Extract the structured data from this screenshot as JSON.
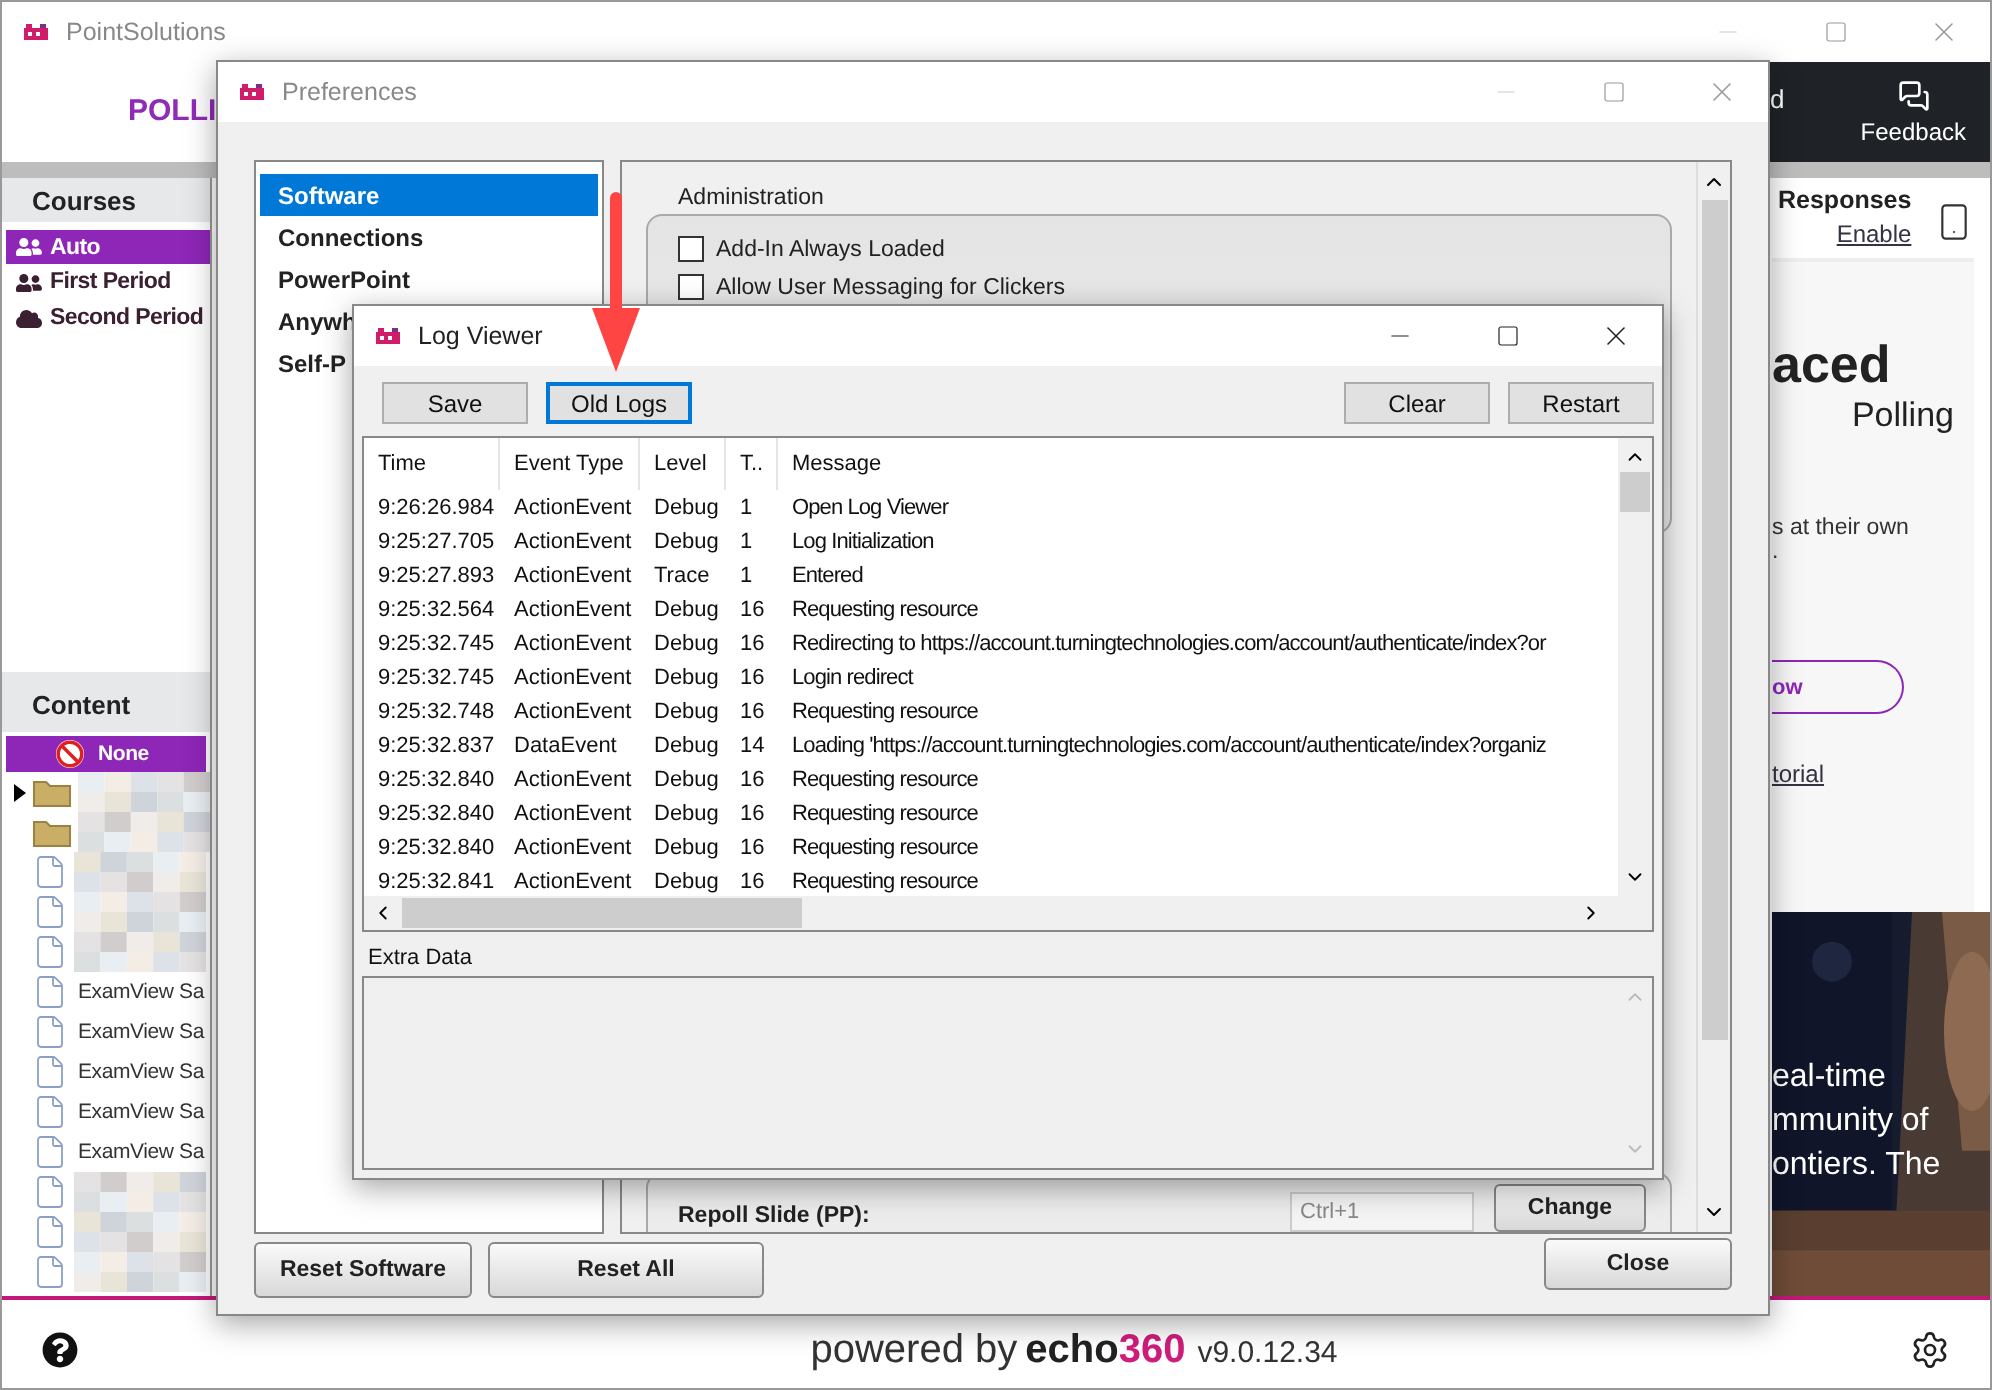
{
  "main_window": {
    "title": "PointSolutions",
    "header_title": "POLLI",
    "header_fragment": "d",
    "feedback": "Feedback",
    "courses": {
      "heading": "Courses",
      "items": [
        {
          "label": "Auto",
          "selected": true,
          "kind": "group"
        },
        {
          "label": "First Period",
          "selected": false,
          "kind": "group"
        },
        {
          "label": "Second Period",
          "selected": false,
          "kind": "cloud"
        }
      ]
    },
    "content": {
      "heading": "Content",
      "items": [
        {
          "kind": "none",
          "label": "None",
          "selected": true,
          "expandable": false
        },
        {
          "kind": "folder",
          "selected": false,
          "expandable": true
        },
        {
          "kind": "folder",
          "selected": false,
          "expandable": false
        },
        {
          "kind": "file",
          "selected": false,
          "expandable": false
        },
        {
          "kind": "file",
          "selected": false,
          "expandable": false
        },
        {
          "kind": "file",
          "selected": false,
          "expandable": false
        },
        {
          "kind": "file",
          "label": "ExamView Sa",
          "selected": false,
          "expandable": false
        },
        {
          "kind": "file",
          "label": "ExamView Sa",
          "selected": false,
          "expandable": false
        },
        {
          "kind": "file",
          "label": "ExamView Sa",
          "selected": false,
          "expandable": false
        },
        {
          "kind": "file",
          "label": "ExamView Sa",
          "selected": false,
          "expandable": false
        },
        {
          "kind": "file",
          "label": "ExamView Sa",
          "selected": false,
          "expandable": false
        },
        {
          "kind": "file",
          "selected": false,
          "expandable": false
        },
        {
          "kind": "file",
          "selected": false,
          "expandable": false
        },
        {
          "kind": "file",
          "selected": false,
          "expandable": false
        }
      ]
    },
    "right_panel": {
      "responses": "Responses",
      "enable": "Enable",
      "headline": "aced",
      "subhead": "Polling",
      "text_lines": [
        "s at their own",
        "."
      ],
      "button": "ow",
      "link": "torial",
      "photo_lines": [
        "eal-time",
        "mmunity of",
        "ontiers. The"
      ]
    },
    "footer": {
      "powered_by": "powered by",
      "brand": "echo",
      "brand_number": "360",
      "version": "v9.0.12.34"
    }
  },
  "preferences": {
    "title": "Preferences",
    "categories": [
      {
        "label": "Software",
        "selected": true
      },
      {
        "label": "Connections",
        "selected": false
      },
      {
        "label": "PowerPoint",
        "selected": false
      },
      {
        "label": "Anywh",
        "selected": false
      },
      {
        "label": "Self-P",
        "selected": false
      }
    ],
    "group_title": "Administration",
    "options": [
      {
        "label": "Add-In Always Loaded",
        "checked": false
      },
      {
        "label": "Allow User Messaging for Clickers",
        "checked": false
      }
    ],
    "shortcut": {
      "label": "Repoll Slide (PP):",
      "value": "Ctrl+1",
      "button": "Change"
    },
    "buttons": [
      "Reset Software",
      "Reset All"
    ],
    "close": "Close"
  },
  "log_viewer": {
    "title": "Log Viewer",
    "buttons_left": [
      {
        "label": "Save",
        "focused": false
      },
      {
        "label": "Old Logs",
        "focused": true
      }
    ],
    "buttons_right": [
      "Clear",
      "Restart"
    ],
    "columns": [
      "Time",
      "Event Type",
      "Level",
      "T..",
      "Message"
    ],
    "rows": [
      [
        "9:26:26.984",
        "ActionEvent",
        "Debug",
        "1",
        "Open Log Viewer"
      ],
      [
        "9:25:27.705",
        "ActionEvent",
        "Debug",
        "1",
        "Log Initialization"
      ],
      [
        "9:25:27.893",
        "ActionEvent",
        "Trace",
        "1",
        "Entered"
      ],
      [
        "9:25:32.564",
        "ActionEvent",
        "Debug",
        "16",
        "Requesting resource"
      ],
      [
        "9:25:32.745",
        "ActionEvent",
        "Debug",
        "16",
        "Redirecting to https://account.turningtechnologies.com/account/authenticate/index?or"
      ],
      [
        "9:25:32.745",
        "ActionEvent",
        "Debug",
        "16",
        "Login redirect"
      ],
      [
        "9:25:32.748",
        "ActionEvent",
        "Debug",
        "16",
        "Requesting resource"
      ],
      [
        "9:25:32.837",
        "DataEvent",
        "Debug",
        "14",
        "Loading 'https://account.turningtechnologies.com/account/authenticate/index?organiz"
      ],
      [
        "9:25:32.840",
        "ActionEvent",
        "Debug",
        "16",
        "Requesting resource"
      ],
      [
        "9:25:32.840",
        "ActionEvent",
        "Debug",
        "16",
        "Requesting resource"
      ],
      [
        "9:25:32.840",
        "ActionEvent",
        "Debug",
        "16",
        "Requesting resource"
      ],
      [
        "9:25:32.841",
        "ActionEvent",
        "Debug",
        "16",
        "Requesting resource"
      ]
    ],
    "extra_data_label": "Extra Data"
  }
}
